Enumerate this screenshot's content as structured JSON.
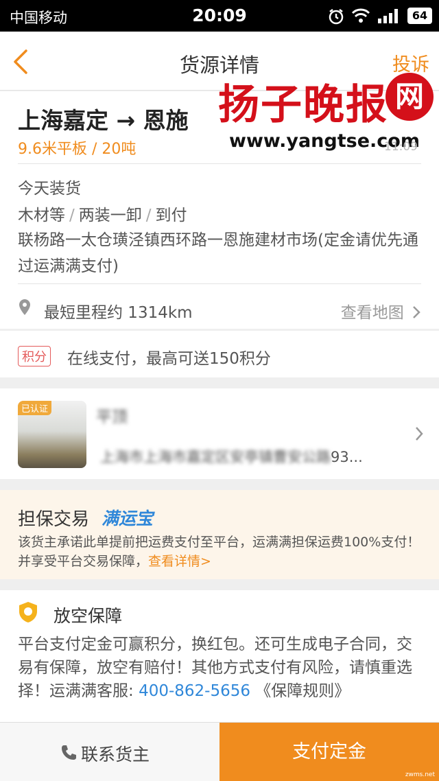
{
  "status_bar": {
    "carrier": "中国移动",
    "time": "20:09",
    "battery": "64"
  },
  "nav": {
    "title": "货源详情",
    "complain": "投诉"
  },
  "watermark": {
    "logo_text": "扬子晚报",
    "logo_badge": "网",
    "url": "www.yangtse.com",
    "time_partial": "11:09"
  },
  "cargo": {
    "route": "上海嘉定 → 恩施",
    "spec": "9.6米平板 / 20吨",
    "load_time": "今天装货",
    "tags": [
      "木材等",
      "两装一卸",
      "到付"
    ],
    "address": "联杨路一太仓璜泾镇西环路一恩施建材市场(定金请优先通过运满满支付)",
    "distance": "最短里程约 1314km",
    "map_link": "查看地图"
  },
  "points": {
    "badge": "积分",
    "text": "在线支付，最高可送150积分"
  },
  "shipper": {
    "verified": "已认证",
    "name": "平顶",
    "address_blur": "上海市上海市嘉定区安亭镇曹安公路",
    "address_tail": "93..."
  },
  "guarantee": {
    "title": "担保交易",
    "brand": "满运宝",
    "desc": "该货主承诺此单提前把运费支付至平台，运满满担保运费100%支付！并享受平台交易保障，",
    "link": "查看详情>"
  },
  "protection": {
    "title": "放空保障",
    "desc": "平台支付定金可赢积分，换红包。还可生成电子合同，交易有保障，放空有赔付！其他方式支付有风险，请慎重选择！运满满客服: ",
    "phone": "400-862-5656",
    "rules": " 《保障规则》"
  },
  "bottom": {
    "contact": "联系货主",
    "pay": "支付定金"
  },
  "site_mark": "zwms.net",
  "colors": {
    "accent": "#f08c1e",
    "link_blue": "#2f87d9",
    "points_red": "#e45a5a",
    "watermark_red": "#d4101a"
  }
}
